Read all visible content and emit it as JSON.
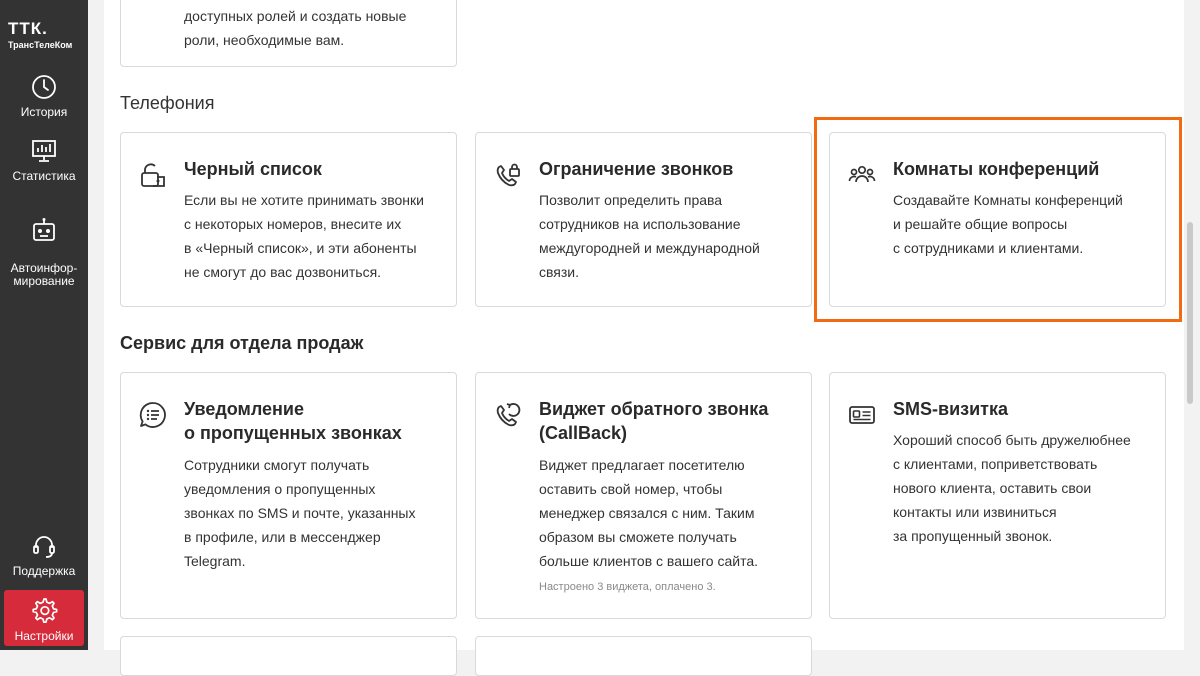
{
  "logo": {
    "main": "ТТК.",
    "sub": "ТрансТелеКом"
  },
  "nav": {
    "history": "История",
    "stats": "Статистика",
    "autoinform": "Автоинфор-\nмирование",
    "support": "Поддержка",
    "settings": "Настройки"
  },
  "top_card": {
    "desc_line1": "доступных ролей и создать новые",
    "desc_line2": "роли, необходимые вам."
  },
  "telephony": {
    "title": "Телефония",
    "cards": [
      {
        "title": "Черный список",
        "icon": "lock-phone-icon",
        "desc": [
          "Если вы не хотите принимать звонки",
          "с некоторых номеров, внесите их",
          "в «Черный список», и эти абоненты",
          "не смогут до вас дозвониться."
        ]
      },
      {
        "title": "Ограничение звонков",
        "icon": "phone-lock-icon",
        "desc": [
          "Позволит определить права",
          "сотрудников на использование",
          "междугородней и международной",
          "связи."
        ]
      },
      {
        "title": "Комнаты конференций",
        "icon": "people-icon",
        "desc": [
          "Создавайте Комнаты конференций",
          "и решайте общие вопросы",
          "с сотрудниками и клиентами."
        ]
      }
    ]
  },
  "sales": {
    "title": "Сервис для отдела продаж",
    "cards": [
      {
        "title": "Уведомление\nо пропущенных звонках",
        "icon": "chat-list-icon",
        "desc": [
          "Сотрудники смогут получать",
          "уведомления о пропущенных",
          "звонках по SMS и почте, указанных",
          "в профиле, или в мессенджер",
          "Telegram."
        ]
      },
      {
        "title": "Виджет обратного звонка\n(CallBack)",
        "icon": "callback-phone-icon",
        "desc": [
          "Виджет предлагает посетителю",
          "оставить свой номер, чтобы",
          "менеджер связался с ним. Таким",
          "образом вы сможете получать",
          "больше клиентов с вашего сайта."
        ],
        "note": "Настроено 3 виджета, оплачено 3."
      },
      {
        "title": "SMS-визитка",
        "icon": "id-card-icon",
        "desc": [
          "Хороший способ быть дружелюбнее",
          "с клиентами, поприветствовать",
          "нового клиента, оставить свои",
          "контакты или извиниться",
          "за пропущенный звонок."
        ]
      }
    ]
  },
  "colors": {
    "sidebar": "#333333",
    "active": "#d62b3a",
    "highlight": "#f26b12"
  }
}
